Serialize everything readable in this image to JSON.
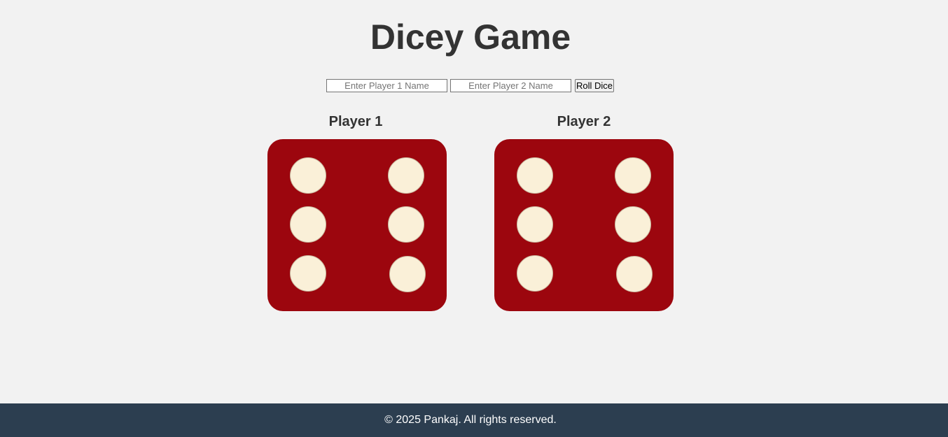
{
  "page": {
    "title": "Dicey Game"
  },
  "controls": {
    "player1_placeholder": "Enter Player 1 Name",
    "player1_value": "",
    "player2_placeholder": "Enter Player 2 Name",
    "player2_value": "",
    "roll_button_label": "Roll Dice"
  },
  "players": [
    {
      "label": "Player 1",
      "die_value": 6
    },
    {
      "label": "Player 2",
      "die_value": 6
    }
  ],
  "colors": {
    "background": "#f2f2f2",
    "die_face": "#9c060e",
    "pip": "#faf0d8",
    "heading_text": "#333333",
    "footer_background": "#2c3e50",
    "footer_text": "#ffffff"
  },
  "footer": {
    "text": "© 2025 Pankaj. All rights reserved."
  }
}
